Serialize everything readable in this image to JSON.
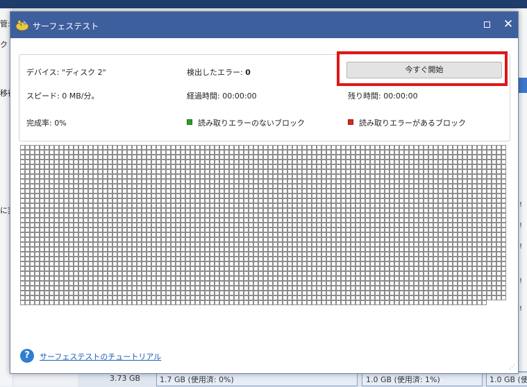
{
  "background": {
    "left_fragments": [
      "管:",
      "ク",
      "移行",
      "に変"
    ],
    "right_marks": [
      "!",
      "!",
      "!",
      "!",
      "!"
    ],
    "bottom_row": {
      "size": "3.73 GB",
      "cell1": "1.7 GB (使用済: 0%)",
      "cell2": "1.0 GB (使用済: 1%)",
      "cell3": "1.0 GB (使"
    }
  },
  "dialog": {
    "title": "サーフェステスト",
    "info": {
      "device_label": "デバイス:",
      "device_value": "\"ディスク 2\"",
      "errors_label": "検出したエラー:",
      "errors_value": "0",
      "speed_label": "スピード:",
      "speed_value": "0 MB/分。",
      "elapsed_label": "経過時間:",
      "elapsed_value": "00:00:00",
      "remaining_label": "残り時間:",
      "remaining_value": "00:00:00",
      "completion_label": "完成率:",
      "completion_value": "0%",
      "legend_ok": "読み取りエラーのないブロック",
      "legend_error": "読み取りエラーがあるブロック"
    },
    "start_button": "今すぐ開始",
    "tutorial_link": "サーフェステストのチュートリアル",
    "colors": {
      "title_bar": "#3e5f9d",
      "ok_block": "#2e9e2e",
      "error_block": "#d52b1e",
      "highlight": "#e01515"
    }
  }
}
